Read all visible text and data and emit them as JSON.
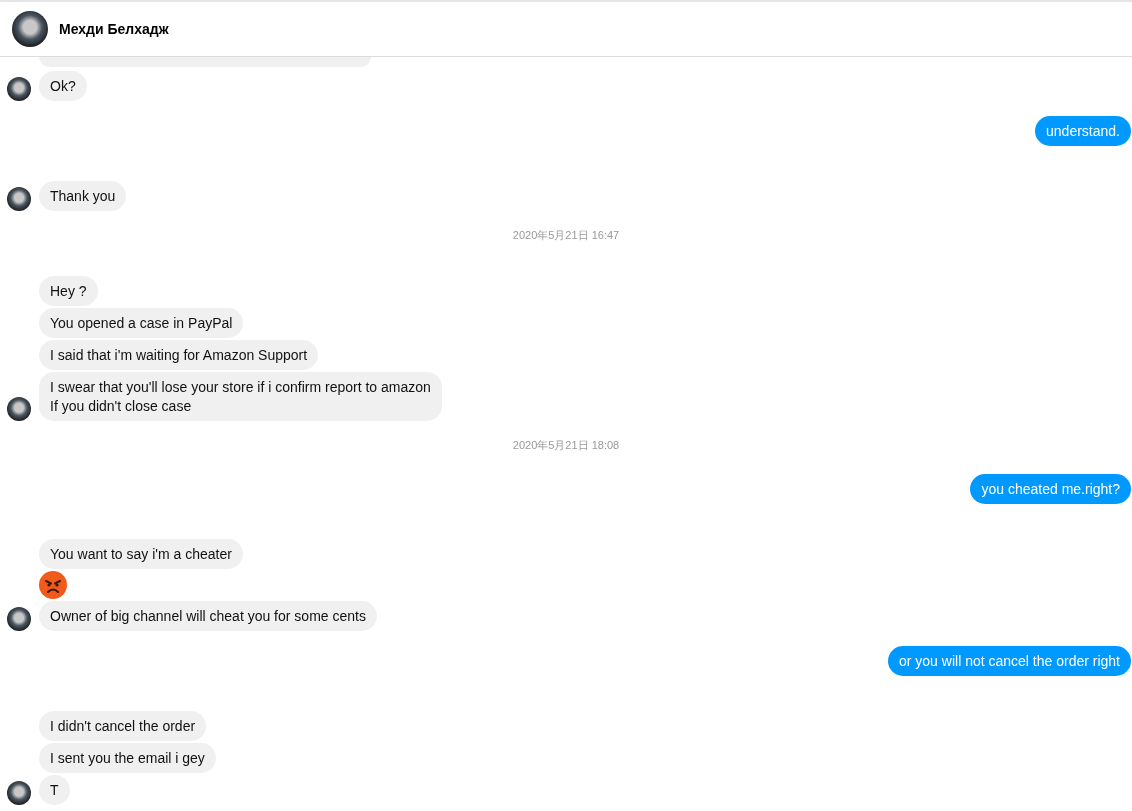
{
  "header": {
    "name": "Мехди Белхадж"
  },
  "messages": [
    {
      "kind": "cut"
    },
    {
      "kind": "in",
      "text": "Ok?",
      "avatar": true
    },
    {
      "kind": "out",
      "text": "understand."
    },
    {
      "kind": "in",
      "text": "Thank you",
      "avatar": true
    },
    {
      "kind": "time",
      "text": "2020年5月21日 16:47"
    },
    {
      "kind": "in",
      "text": "Hey ?",
      "avatar": false
    },
    {
      "kind": "in",
      "text": "You opened a case in PayPal",
      "avatar": false
    },
    {
      "kind": "in",
      "text": "I said that i'm waiting for Amazon Support",
      "avatar": false
    },
    {
      "kind": "in",
      "text": "I swear that you'll lose your store if i confirm report to amazon\nIf you didn't close case",
      "avatar": true
    },
    {
      "kind": "time",
      "text": "2020年5月21日 18:08"
    },
    {
      "kind": "out",
      "text": "you cheated me.right?"
    },
    {
      "kind": "in",
      "text": "You want to say i'm a cheater",
      "avatar": false
    },
    {
      "kind": "emoji",
      "avatar": false
    },
    {
      "kind": "in",
      "text": "Owner of big channel will cheat you for some cents",
      "avatar": true
    },
    {
      "kind": "out",
      "text": "or you will not cancel the order right"
    },
    {
      "kind": "in",
      "text": "I didn't cancel the order",
      "avatar": false
    },
    {
      "kind": "in",
      "text": "I sent you the email i gey",
      "avatar": false
    },
    {
      "kind": "in",
      "text": "T",
      "avatar": true
    }
  ]
}
